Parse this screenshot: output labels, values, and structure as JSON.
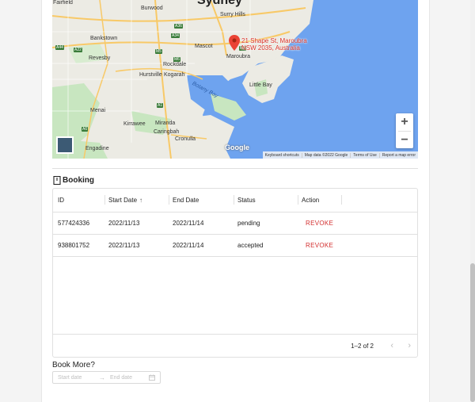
{
  "map": {
    "city_label": "Sydney",
    "marker_address": "21 Shape St, Maroubra NSW 2035, Australia",
    "suburbs": [
      "Fairfield",
      "Burwood",
      "Surry Hills",
      "Bankstown",
      "Revesby",
      "Mascot",
      "Maroubra",
      "Rockdale",
      "Hurstville",
      "Kogarah",
      "Little Bay",
      "Menai",
      "Kirrawee",
      "Miranda",
      "Caringbah",
      "Cronulla",
      "Engadine"
    ],
    "water_label": "Botany Bay",
    "highway_badges": [
      "A44",
      "A34",
      "M5",
      "A1",
      "A22",
      "M1",
      "A6",
      "A36",
      "M6"
    ],
    "google_logo": "Google",
    "zoom_in": "+",
    "zoom_out": "−",
    "footer_links": [
      "Keyboard shortcuts",
      "Map data ©2022 Google",
      "Terms of Use",
      "Report a map error"
    ]
  },
  "booking": {
    "title": "Booking",
    "columns": [
      "ID",
      "Start Date",
      "End Date",
      "Status",
      "Action"
    ],
    "sort_indicator": "↑",
    "rows": [
      {
        "id": "577424336",
        "start": "2022/11/13",
        "end": "2022/11/14",
        "status": "pending",
        "action": "REVOKE"
      },
      {
        "id": "938801752",
        "start": "2022/11/13",
        "end": "2022/11/14",
        "status": "accepted",
        "action": "REVOKE"
      }
    ],
    "pagination": "1–2 of 2",
    "prev_page": "‹",
    "next_page": "›"
  },
  "book_more": {
    "label": "Book More?",
    "start_placeholder": "Start date",
    "separator": "→",
    "end_placeholder": "End date"
  },
  "colors": {
    "accent_red": "#d32f2f",
    "water": "#6ea3ef",
    "land": "#e8e8e0",
    "park": "#c8e6c0"
  },
  "icons": [
    "book-icon",
    "map-pin-icon",
    "calendar-icon",
    "arrow-up-icon",
    "chevron-left-icon",
    "chevron-right-icon"
  ]
}
